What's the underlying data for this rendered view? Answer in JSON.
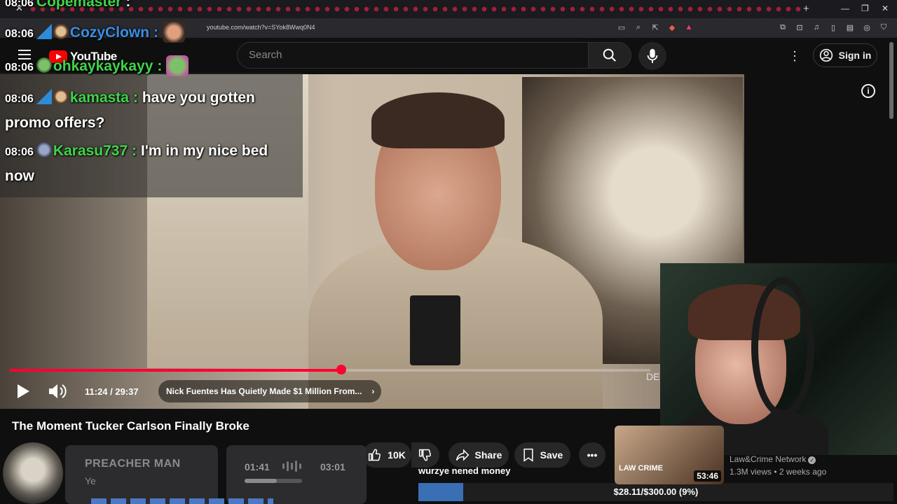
{
  "browser": {
    "url": "youtube.com/watch?v=SYok8Wwq0N4"
  },
  "youtube": {
    "logo_text": "YouTube",
    "search_placeholder": "Search",
    "sign_in_label": "Sign in"
  },
  "chat": {
    "messages": [
      {
        "time": "08:06",
        "user": "Copemaster",
        "text": "",
        "user_color": "#3fd44a"
      },
      {
        "time": "08:06",
        "user": "CozyClown",
        "text": "",
        "user_color": "#3a8ee6"
      },
      {
        "time": "08:06",
        "user": "ohkaykaykayy",
        "text": "",
        "user_color": "#3fd44a"
      },
      {
        "time": "08:06",
        "user": "kamasta",
        "text": "have you gotten promo offers?",
        "user_color": "#3fd44a"
      },
      {
        "time": "08:06",
        "user": "Karasu737",
        "text": "I'm in my nice bed now",
        "user_color": "#3fd44a"
      }
    ]
  },
  "player": {
    "time_current": "11:24",
    "time_total": "29:37",
    "time_separator": " / ",
    "progress_fraction": 0.518,
    "buffered_fraction": 0.6,
    "chapter_title": "Nick Fuentes Has Quietly Made $1 Million From...",
    "overlay_tag": "DE"
  },
  "video": {
    "title": "The Moment Tucker Carlson Finally Broke",
    "like_count": "10K",
    "share_label": "Share",
    "save_label": "Save"
  },
  "music_widget": {
    "song": "PREACHER MAN",
    "artist": "Ye",
    "elapsed": "01:41",
    "duration": "03:01",
    "progress_fraction": 0.56
  },
  "donation_goal": {
    "message": "wurzye nened money",
    "label": "$28.11/$300.00 (9%)",
    "fraction": 0.0937
  },
  "recommendation": {
    "duration": "53:46",
    "brand": "LAW CRIME",
    "channel": "Law&Crime Network",
    "meta": "1.3M views • 2 weeks ago"
  },
  "colors": {
    "accent_red": "#ff0033",
    "youtube_red": "#ff0000",
    "goal_blue": "#3a6fb5"
  }
}
